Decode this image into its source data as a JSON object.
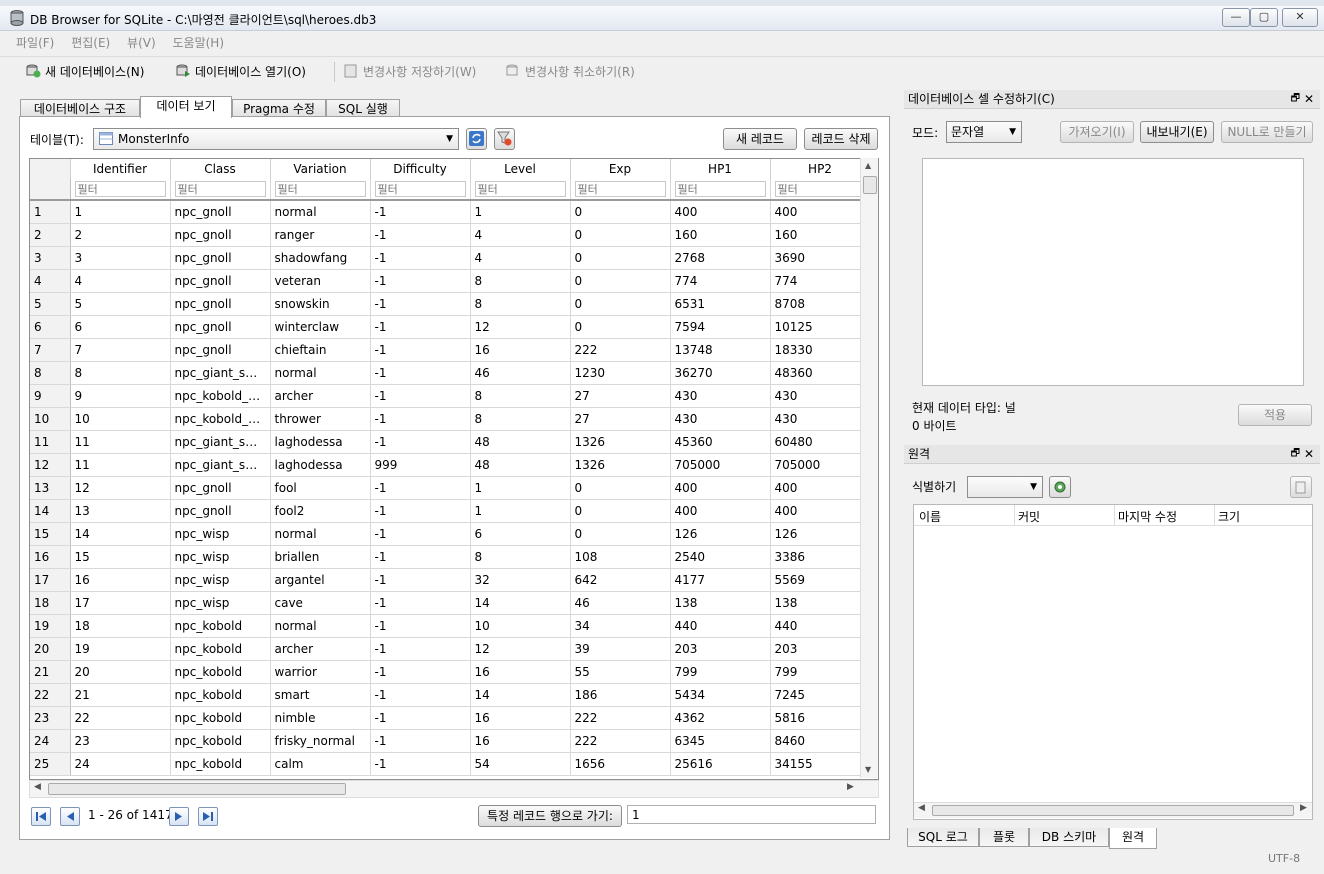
{
  "window": {
    "title": "DB Browser for SQLite - C:\\마영전 클라이언트\\sql\\heroes.db3"
  },
  "menu": [
    "파일(F)",
    "편집(E)",
    "뷰(V)",
    "도움말(H)"
  ],
  "toolbar": {
    "new_db": "새 데이터베이스(N)",
    "open_db": "데이터베이스 열기(O)",
    "write_changes": "변경사항 저장하기(W)",
    "revert_changes": "변경사항 취소하기(R)"
  },
  "tabs": [
    "데이터베이스 구조",
    "데이터 보기",
    "Pragma 수정",
    "SQL 실행"
  ],
  "browse": {
    "table_label": "테이블(T):",
    "table_value": "MonsterInfo",
    "new_record": "새 레코드",
    "delete_record": "레코드 삭제",
    "filter_placeholder": "필터",
    "columns": [
      "Identifier",
      "Class",
      "Variation",
      "Difficulty",
      "Level",
      "Exp",
      "HP1",
      "HP2"
    ],
    "rows": [
      [
        "1",
        "1",
        "npc_gnoll",
        "normal",
        "-1",
        "1",
        "0",
        "400",
        "400"
      ],
      [
        "2",
        "2",
        "npc_gnoll",
        "ranger",
        "-1",
        "4",
        "0",
        "160",
        "160"
      ],
      [
        "3",
        "3",
        "npc_gnoll",
        "shadowfang",
        "-1",
        "4",
        "0",
        "2768",
        "3690"
      ],
      [
        "4",
        "4",
        "npc_gnoll",
        "veteran",
        "-1",
        "8",
        "0",
        "774",
        "774"
      ],
      [
        "5",
        "5",
        "npc_gnoll",
        "snowskin",
        "-1",
        "8",
        "0",
        "6531",
        "8708"
      ],
      [
        "6",
        "6",
        "npc_gnoll",
        "winterclaw",
        "-1",
        "12",
        "0",
        "7594",
        "10125"
      ],
      [
        "7",
        "7",
        "npc_gnoll",
        "chieftain",
        "-1",
        "16",
        "222",
        "13748",
        "18330"
      ],
      [
        "8",
        "8",
        "npc_giant_s…",
        "normal",
        "-1",
        "46",
        "1230",
        "36270",
        "48360"
      ],
      [
        "9",
        "9",
        "npc_kobold_…",
        "archer",
        "-1",
        "8",
        "27",
        "430",
        "430"
      ],
      [
        "10",
        "10",
        "npc_kobold_…",
        "thrower",
        "-1",
        "8",
        "27",
        "430",
        "430"
      ],
      [
        "11",
        "11",
        "npc_giant_s…",
        "laghodessa",
        "-1",
        "48",
        "1326",
        "45360",
        "60480"
      ],
      [
        "12",
        "11",
        "npc_giant_s…",
        "laghodessa",
        "999",
        "48",
        "1326",
        "705000",
        "705000"
      ],
      [
        "13",
        "12",
        "npc_gnoll",
        "fool",
        "-1",
        "1",
        "0",
        "400",
        "400"
      ],
      [
        "14",
        "13",
        "npc_gnoll",
        "fool2",
        "-1",
        "1",
        "0",
        "400",
        "400"
      ],
      [
        "15",
        "14",
        "npc_wisp",
        "normal",
        "-1",
        "6",
        "0",
        "126",
        "126"
      ],
      [
        "16",
        "15",
        "npc_wisp",
        "briallen",
        "-1",
        "8",
        "108",
        "2540",
        "3386"
      ],
      [
        "17",
        "16",
        "npc_wisp",
        "argantel",
        "-1",
        "32",
        "642",
        "4177",
        "5569"
      ],
      [
        "18",
        "17",
        "npc_wisp",
        "cave",
        "-1",
        "14",
        "46",
        "138",
        "138"
      ],
      [
        "19",
        "18",
        "npc_kobold",
        "normal",
        "-1",
        "10",
        "34",
        "440",
        "440"
      ],
      [
        "20",
        "19",
        "npc_kobold",
        "archer",
        "-1",
        "12",
        "39",
        "203",
        "203"
      ],
      [
        "21",
        "20",
        "npc_kobold",
        "warrior",
        "-1",
        "16",
        "55",
        "799",
        "799"
      ],
      [
        "22",
        "21",
        "npc_kobold",
        "smart",
        "-1",
        "14",
        "186",
        "5434",
        "7245"
      ],
      [
        "23",
        "22",
        "npc_kobold",
        "nimble",
        "-1",
        "16",
        "222",
        "4362",
        "5816"
      ],
      [
        "24",
        "23",
        "npc_kobold",
        "frisky_normal",
        "-1",
        "16",
        "222",
        "6345",
        "8460"
      ],
      [
        "25",
        "24",
        "npc_kobold",
        "calm",
        "-1",
        "54",
        "1656",
        "25616",
        "34155"
      ]
    ],
    "range": "1 - 26 of 1417",
    "goto_label": "특정 레코드 행으로 가기:",
    "goto_value": "1"
  },
  "edit_cell": {
    "title": "데이터베이스 셀 수정하기(C)",
    "mode_label": "모드:",
    "mode_value": "문자열",
    "import": "가져오기(I)",
    "export": "내보내기(E)",
    "set_null": "NULL로 만들기",
    "type_info": "현재 데이터 타입: 널",
    "size_info": "0 바이트",
    "apply": "적용"
  },
  "remote": {
    "title": "원격",
    "identity_label": "식별하기",
    "columns": [
      "이름",
      "커밋",
      "마지막 수정",
      "크기"
    ]
  },
  "bottom_tabs": [
    "SQL 로그",
    "플롯",
    "DB 스키마",
    "원격"
  ],
  "status": {
    "encoding": "UTF-8"
  }
}
